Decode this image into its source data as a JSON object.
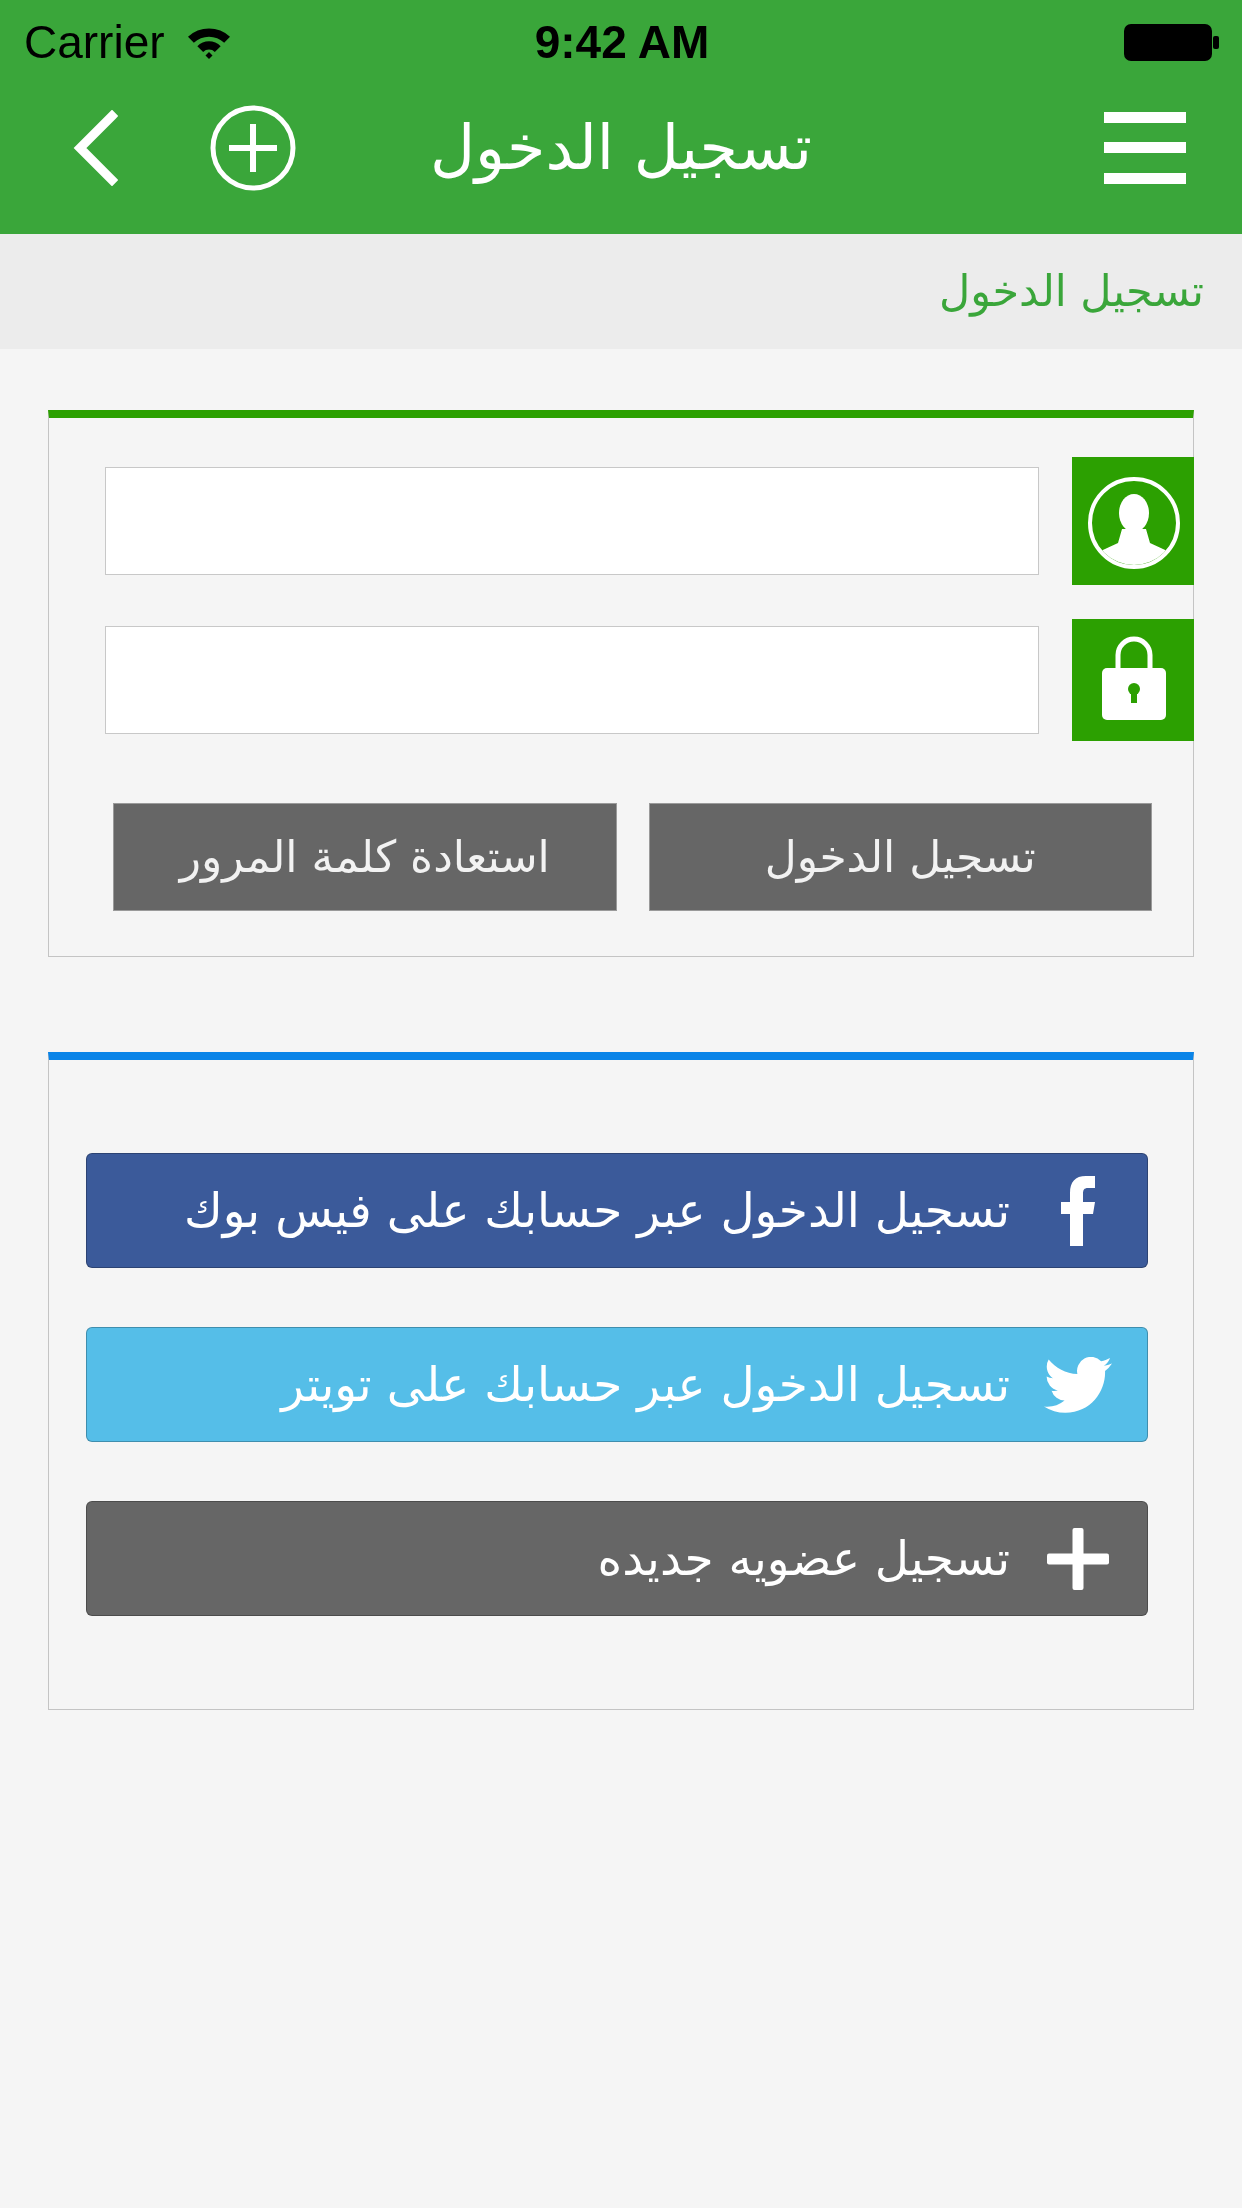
{
  "status_bar": {
    "carrier": "Carrier",
    "time": "9:42 AM"
  },
  "nav_bar": {
    "title": "تسجيل الدخول"
  },
  "breadcrumb": {
    "label": "تسجيل الدخول"
  },
  "login_form": {
    "fields": [
      {
        "kind": "username"
      },
      {
        "kind": "password"
      }
    ],
    "buttons": [
      {
        "label": "تسجيل الدخول"
      },
      {
        "label": "استعادة كلمة المرور"
      }
    ]
  },
  "social_login": {
    "buttons": [
      {
        "kind": "facebook",
        "label": "تسجيل الدخول عبر حسابك على فيس بوك",
        "color": "#3b5a9a"
      },
      {
        "kind": "twitter",
        "label": "تسجيل الدخول عبر حسابك على تويتر",
        "color": "#55bee8"
      },
      {
        "kind": "register",
        "label": "تسجيل عضويه جديده",
        "color": "#666666"
      }
    ]
  }
}
